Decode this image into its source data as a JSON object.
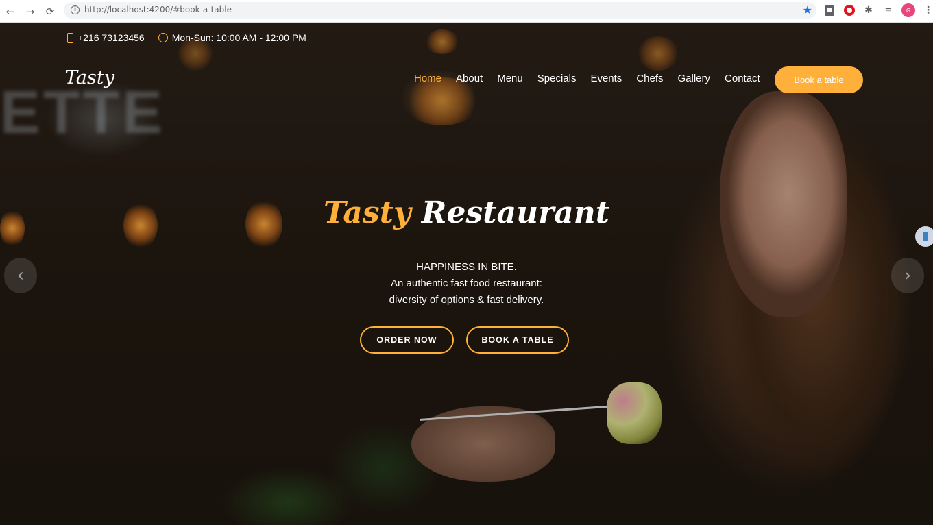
{
  "browser": {
    "url": "http://localhost:4200/#book-a-table",
    "back_icon": "←",
    "forward_icon": "→",
    "reload_icon": "⟳",
    "info_icon": "i",
    "star_icon": "★",
    "puzzle_icon": "✱",
    "media_icon": "≡",
    "avatar_letter": "G",
    "menu_icon": "⋮"
  },
  "topbar": {
    "phone": "+216 73123456",
    "hours": "Mon-Sun: 10:00 AM - 12:00 PM"
  },
  "header": {
    "logo": "Tasty",
    "nav": [
      {
        "label": "Home",
        "active": true
      },
      {
        "label": "About"
      },
      {
        "label": "Menu"
      },
      {
        "label": "Specials"
      },
      {
        "label": "Events"
      },
      {
        "label": "Chefs"
      },
      {
        "label": "Gallery"
      },
      {
        "label": "Contact"
      }
    ],
    "book_button": "Book a table"
  },
  "hero": {
    "title_accent": "Tasty",
    "title_rest": "Restaurant",
    "tagline": "HAPPINESS IN BITE.",
    "line1": "An authentic fast food restaurant:",
    "line2": "diversity of options & fast delivery.",
    "order_button": "ORDER NOW",
    "book_button": "BOOK A TABLE",
    "prev_arrow": "‹",
    "next_arrow": "›"
  },
  "colors": {
    "accent": "#ffb03b",
    "text": "#ffffff"
  }
}
